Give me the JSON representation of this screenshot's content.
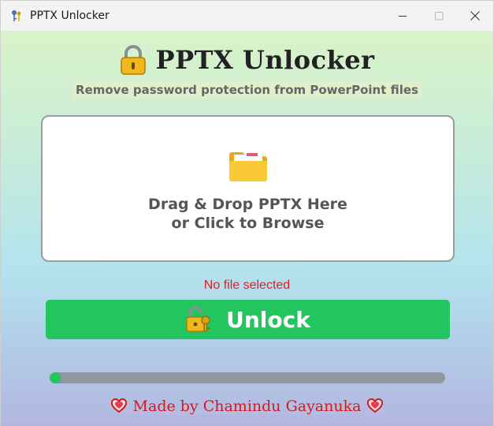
{
  "window": {
    "title": "PPTX Unlocker",
    "icon": "key-app-icon"
  },
  "header": {
    "title": "PPTX Unlocker",
    "icon": "lock-icon",
    "subtitle": "Remove password protection from PowerPoint files"
  },
  "drop_zone": {
    "icon": "folder-icon",
    "line1": "Drag & Drop PPTX Here",
    "line2": "or Click to Browse"
  },
  "status": {
    "text": "No file selected",
    "color": "#e0201e"
  },
  "unlock_button": {
    "label": "Unlock",
    "icon": "unlock-key-icon",
    "color": "#22c55e"
  },
  "progress": {
    "value": 0.01,
    "fill_color": "#22c55e",
    "track_color": "#8f989e"
  },
  "footer": {
    "text": "Made by Chamindu Gayanuka",
    "icon": "heart-icon"
  }
}
